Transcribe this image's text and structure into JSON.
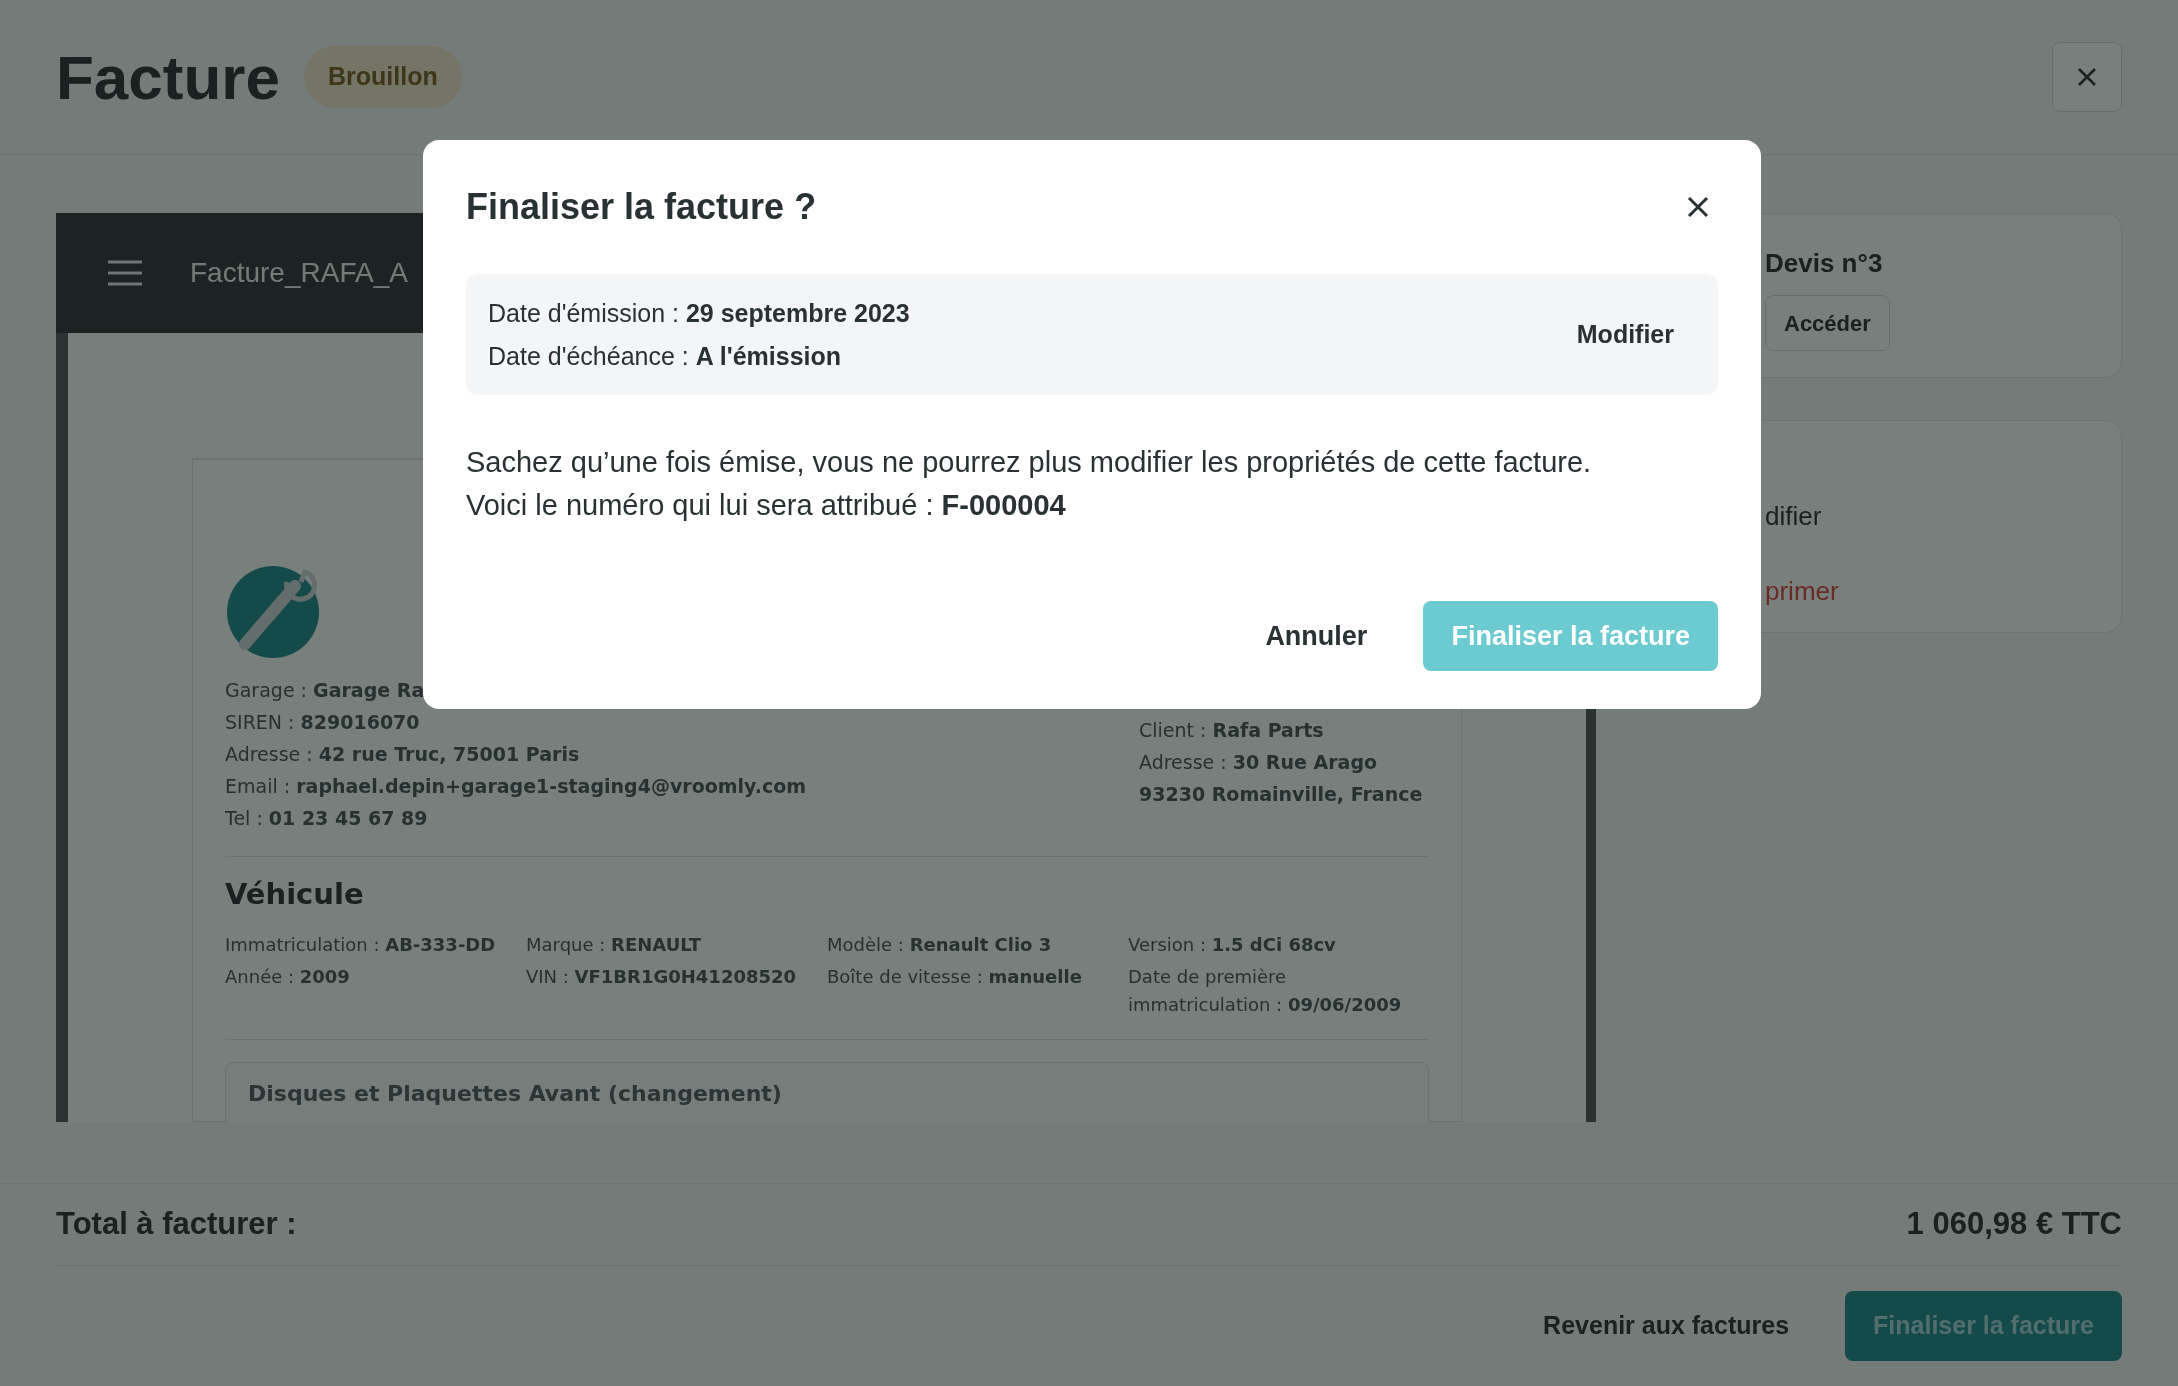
{
  "header": {
    "title": "Facture",
    "status_badge": "Brouillon"
  },
  "document_viewer": {
    "filename": "Facture_RAFA_A",
    "garage_lines": [
      "Garage : **Garage Ra**",
      "SIREN : **829016070**",
      "Adresse : **42 rue Truc, 75001 Paris**",
      "Email : **raphael.depin+garage1-staging4@vroomly.com**",
      "Tel : **01 23 45 67 89**"
    ],
    "client_lines": [
      "Client : **Rafa Parts**",
      "Adresse : **30 Rue Arago**",
      "**93230 Romainville, France**"
    ],
    "vehicle_title": "Véhicule",
    "vehicle_fields": [
      "Immatriculation : **AB-333-DD**",
      "Marque : **RENAULT**",
      "Modèle : **Renault Clio 3**",
      "Version : **1.5 dCi 68cv**",
      "Année : **2009**",
      "VIN : **VF1BR1G0H41208520**",
      "Boîte de vitesse : **manuelle**",
      "Date de première immatriculation : **09/06/2009**"
    ],
    "section_title": "Disques et Plaquettes Avant (changement)"
  },
  "side_panel": {
    "quote_title": "Devis n°3",
    "quote_button": "Accéder",
    "actions": [
      {
        "label": "difier",
        "kind": "normal"
      },
      {
        "label": "primer",
        "kind": "danger"
      }
    ]
  },
  "footer": {
    "total_label": "Total à facturer :",
    "total_value": "1 060,98 € TTC",
    "back_button": "Revenir aux factures",
    "finalize_button": "Finaliser la facture"
  },
  "dialog": {
    "title": "Finaliser la facture ?",
    "info_lines": [
      "Date d'émission : **29 septembre 2023**",
      "Date d'échéance : **A l'émission**"
    ],
    "edit_button": "Modifier",
    "message_lines": [
      "Sachez qu’une fois émise, vous ne pourrez plus modifier les propriétés de cette facture.",
      "Voici le numéro qui lui sera attribué : **F-000004**"
    ],
    "cancel_button": "Annuler",
    "confirm_button": "Finaliser la facture"
  }
}
